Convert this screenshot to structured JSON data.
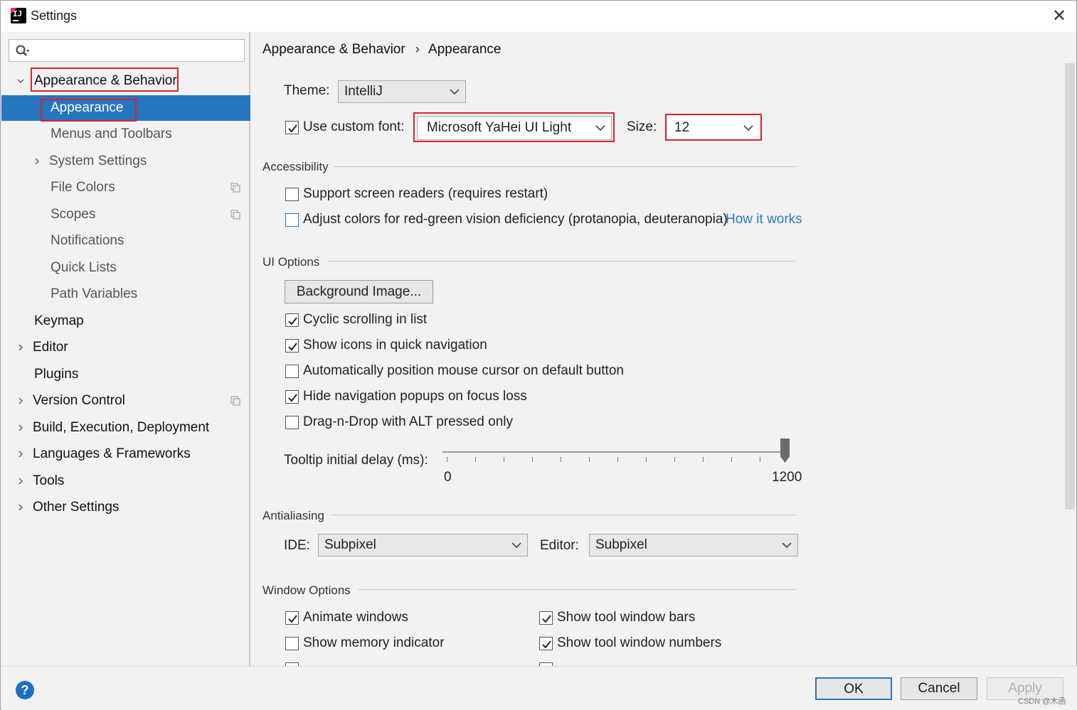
{
  "window": {
    "title": "Settings"
  },
  "sidebar": {
    "search": {
      "placeholder": ""
    },
    "items": [
      {
        "label": "Appearance & Behavior",
        "expanded": true
      },
      {
        "label": "Appearance",
        "selected": true
      },
      {
        "label": "Menus and Toolbars"
      },
      {
        "label": "System Settings"
      },
      {
        "label": "File Colors"
      },
      {
        "label": "Scopes"
      },
      {
        "label": "Notifications"
      },
      {
        "label": "Quick Lists"
      },
      {
        "label": "Path Variables"
      },
      {
        "label": "Keymap"
      },
      {
        "label": "Editor"
      },
      {
        "label": "Plugins"
      },
      {
        "label": "Version Control"
      },
      {
        "label": "Build, Execution, Deployment"
      },
      {
        "label": "Languages & Frameworks"
      },
      {
        "label": "Tools"
      },
      {
        "label": "Other Settings"
      }
    ]
  },
  "breadcrumb": {
    "parent": "Appearance & Behavior",
    "separator": "›",
    "current": "Appearance"
  },
  "theme": {
    "label": "Theme:",
    "value": "IntelliJ"
  },
  "custom_font": {
    "checked": true,
    "label": "Use custom font:",
    "value": "Microsoft YaHei UI Light",
    "size_label": "Size:",
    "size_value": "12"
  },
  "accessibility": {
    "title": "Accessibility",
    "screen_readers": {
      "checked": false,
      "label": "Support screen readers (requires restart)"
    },
    "color_adjust": {
      "checked": false,
      "label": "Adjust colors for red-green vision deficiency (protanopia, deuteranopia)"
    },
    "how_it_works": "How it works"
  },
  "ui_options": {
    "title": "UI Options",
    "background_image_button": "Background Image...",
    "cyclic": {
      "checked": true,
      "label": "Cyclic scrolling in list"
    },
    "show_icons": {
      "checked": true,
      "label": "Show icons in quick navigation"
    },
    "auto_mouse": {
      "checked": false,
      "label": "Automatically position mouse cursor on default button"
    },
    "hide_popups": {
      "checked": true,
      "label": "Hide navigation popups on focus loss"
    },
    "drag_drop": {
      "checked": false,
      "label": "Drag-n-Drop with ALT pressed only"
    },
    "tooltip": {
      "label": "Tooltip initial delay (ms):",
      "min": "0",
      "max": "1200",
      "value": 1200
    }
  },
  "antialiasing": {
    "title": "Antialiasing",
    "ide_label": "IDE:",
    "ide_value": "Subpixel",
    "editor_label": "Editor:",
    "editor_value": "Subpixel"
  },
  "window_options": {
    "title": "Window Options",
    "animate": {
      "checked": true,
      "label": "Animate windows"
    },
    "memory": {
      "checked": false,
      "label": "Show memory indicator"
    },
    "tool_bars": {
      "checked": true,
      "label": "Show tool window bars"
    },
    "tool_numbers": {
      "checked": true,
      "label": "Show tool window numbers"
    }
  },
  "footer": {
    "help": "?",
    "ok": "OK",
    "cancel": "Cancel",
    "apply": "Apply"
  },
  "watermark": "CSDN @木函",
  "colors": {
    "accent": "#2675bf",
    "highlight": "#e0202e",
    "link": "#2d7bc4"
  }
}
